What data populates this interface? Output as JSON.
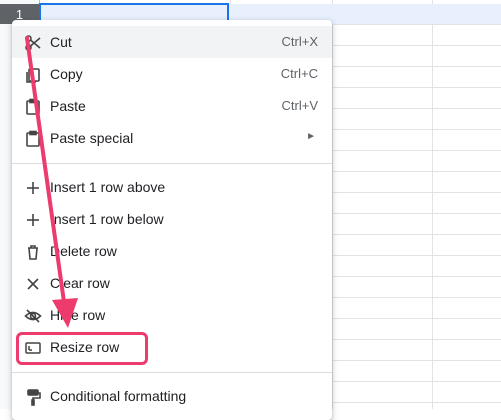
{
  "spreadsheet": {
    "selected_row_number": "1"
  },
  "context_menu": {
    "items": [
      {
        "label": "Cut",
        "shortcut": "Ctrl+X",
        "icon": "scissors-icon"
      },
      {
        "label": "Copy",
        "shortcut": "Ctrl+C",
        "icon": "copy-icon"
      },
      {
        "label": "Paste",
        "shortcut": "Ctrl+V",
        "icon": "paste-icon"
      },
      {
        "label": "Paste special",
        "submenu_glyph": "►",
        "icon": "clipboard-icon"
      },
      {
        "label": "Insert 1 row above",
        "icon": "plus-icon"
      },
      {
        "label": "Insert 1 row below",
        "icon": "plus-icon"
      },
      {
        "label": "Delete row",
        "icon": "trash-icon"
      },
      {
        "label": "Clear row",
        "icon": "close-icon"
      },
      {
        "label": "Hide row",
        "icon": "eye-slash-icon"
      },
      {
        "label": "Resize row",
        "icon": "resize-icon"
      },
      {
        "label": "Conditional formatting",
        "icon": "paint-roller-icon"
      }
    ],
    "hovered_item": "Cut",
    "highlighted_item": "Resize row"
  },
  "annotation": {
    "color": "#ec3b6c"
  }
}
